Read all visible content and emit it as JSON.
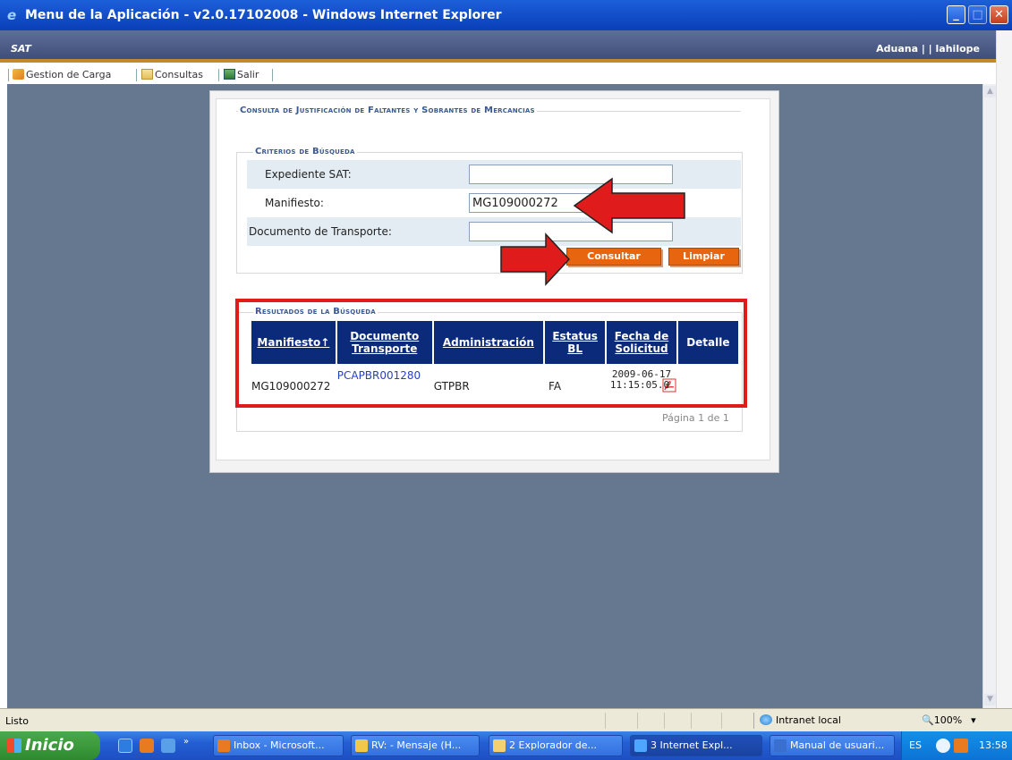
{
  "window": {
    "title": "Menu de la Aplicación - v2.0.17102008 - Windows Internet Explorer",
    "icon": "ie-icon"
  },
  "app": {
    "logo": "SAT",
    "user": "Aduana | | lahilope"
  },
  "menu": {
    "items": [
      {
        "label": "Gestion de Carga",
        "icon": "cargo-icon"
      },
      {
        "label": "Consultas",
        "icon": "folder-icon"
      },
      {
        "label": "Salir",
        "icon": "exit-icon"
      }
    ]
  },
  "form": {
    "title": "Consulta de Justificación de Faltantes y Sobrantes de Mercancias",
    "criteria_title": "Criterios de Búsqueda",
    "fields": {
      "expediente": {
        "label": "Expediente SAT:",
        "value": ""
      },
      "manifiesto": {
        "label": "Manifiesto:",
        "value": "MG109000272"
      },
      "documento": {
        "label": "Documento de Transporte:",
        "value": ""
      }
    },
    "consultar_label": "Consultar",
    "limpiar_label": "Limpiar"
  },
  "results": {
    "title": "Resultados de la Búsqueda",
    "columns": [
      "Manifiesto↑",
      "Documento Transporte",
      "Administración",
      "Estatus BL",
      "Fecha de Solicitud",
      "Detalle"
    ],
    "rows": [
      {
        "manifiesto": "MG109000272",
        "documento": "PCAPBR001280",
        "administracion": "GTPBR",
        "estatus": "FA",
        "fecha_date": "2009-06-17",
        "fecha_time": "11:15:05.0",
        "detalle_icon": "pdf-icon"
      }
    ],
    "pager": "Página 1 de 1"
  },
  "status": {
    "text": "Listo",
    "zone": "Intranet local",
    "zoom": "100%"
  },
  "taskbar": {
    "start": "Inicio",
    "items": [
      "Inbox - Microsoft...",
      "RV: - Mensaje (H...",
      "2 Explorador de...",
      "3 Internet Expl...",
      "Manual de usuari..."
    ],
    "lang": "ES",
    "clock": "13:58"
  },
  "colors": {
    "accent_orange": "#e8650f",
    "header_navy": "#0b2a7a",
    "highlight_red": "#e01b1b",
    "background": "#667790"
  }
}
